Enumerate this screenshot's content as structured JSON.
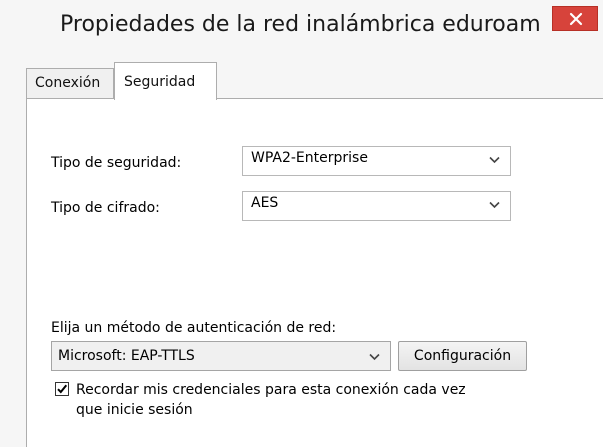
{
  "window": {
    "title": "Propiedades de la red inalámbrica eduroam",
    "close_icon": "close-icon"
  },
  "tabs": [
    {
      "label": "Conexión",
      "active": false
    },
    {
      "label": "Seguridad",
      "active": true
    }
  ],
  "security": {
    "type_label": "Tipo de seguridad:",
    "type_value": "WPA2-Enterprise",
    "cipher_label": "Tipo de cifrado:",
    "cipher_value": "AES"
  },
  "auth": {
    "method_label": "Elija un método de autenticación de red:",
    "method_value": "Microsoft: EAP-TTLS",
    "config_button": "Configuración"
  },
  "remember": {
    "checked": true,
    "label": "Recordar mis credenciales para esta conexión cada vez que inicie sesión"
  },
  "colors": {
    "close_button": "#d7433b",
    "panel_background": "#ffffff",
    "window_background": "#f6f6f6"
  }
}
